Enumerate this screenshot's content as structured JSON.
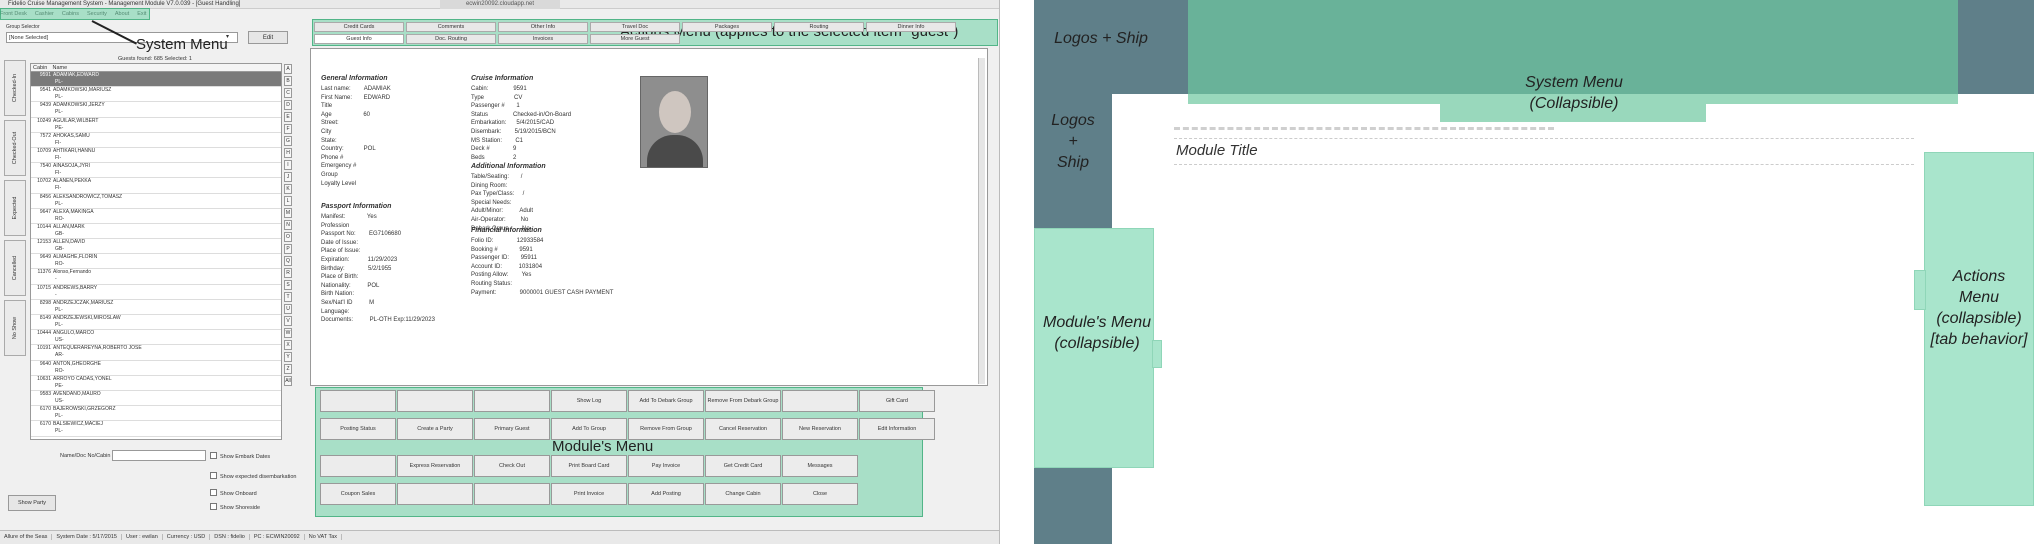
{
  "app": {
    "title": "Fidelio Cruise Management System - Management Module V7.0.039 - [Guest Handling]",
    "url": "ecwin20092.cloudapp.net",
    "menu": [
      "Front Desk",
      "Cashier",
      "Cabins",
      "Security",
      "About",
      "Exit"
    ]
  },
  "group_selector": {
    "label": "Group Selector",
    "value": "[None Selected]",
    "edit_label": "Edit"
  },
  "guest_list": {
    "found_label": "Guests found: 685 Selected: 1",
    "columns": [
      "Cabin",
      "Name"
    ],
    "side_tabs": [
      "Checked-In",
      "Checked-Out",
      "Expected",
      "Cancelled",
      "No Show"
    ],
    "rows": [
      {
        "cabin": "9591",
        "name": "ADAMIAK,EDWARD",
        "nat": "PL-"
      },
      {
        "cabin": "9541",
        "name": "ADAMKOWSKI,MARIUSZ",
        "nat": "PL-"
      },
      {
        "cabin": "9439",
        "name": "ADAMKOWSKI,JERZY",
        "nat": "PL-"
      },
      {
        "cabin": "10249",
        "name": "AGUILAR,WILBERT",
        "nat": "PE-"
      },
      {
        "cabin": "7572",
        "name": "AHOKAS,SAMU",
        "nat": "FI-"
      },
      {
        "cabin": "10709",
        "name": "AHTIKARI,HANNU",
        "nat": "FI-"
      },
      {
        "cabin": "7540",
        "name": "AINASOJA,JYRI",
        "nat": "FI-"
      },
      {
        "cabin": "10702",
        "name": "ALANEN,PEKKA",
        "nat": "FI-"
      },
      {
        "cabin": "8456",
        "name": "ALEKSANDROWICZ,TOMASZ",
        "nat": "PL-"
      },
      {
        "cabin": "9647",
        "name": "ALEXA,MAKINGA",
        "nat": "RO-"
      },
      {
        "cabin": "10144",
        "name": "ALLAN,MARK",
        "nat": "GB-"
      },
      {
        "cabin": "12153",
        "name": "ALLEN,DAVID",
        "nat": "GB-"
      },
      {
        "cabin": "9649",
        "name": "ALMAGHE,FLORIN",
        "nat": "RO-"
      },
      {
        "cabin": "11376",
        "name": "Alonso,Fernando",
        "nat": "-"
      },
      {
        "cabin": "10715",
        "name": "ANDREWS,BARRY",
        "nat": "-"
      },
      {
        "cabin": "8298",
        "name": "ANDRZEJCZAK,MARIUSZ",
        "nat": "PL-"
      },
      {
        "cabin": "8149",
        "name": "ANDRZEJEWSKI,MIROSLAW",
        "nat": "PL-"
      },
      {
        "cabin": "10444",
        "name": "ANGULO,MARCO",
        "nat": "US-"
      },
      {
        "cabin": "10191",
        "name": "ANTEQUERAREYNA,ROBERTO JOSE",
        "nat": "AR-"
      },
      {
        "cabin": "9640",
        "name": "ANTON,GHEORGHE",
        "nat": "RO-"
      },
      {
        "cabin": "10631",
        "name": "ARROYO CADAS,YONEL",
        "nat": "PE-"
      },
      {
        "cabin": "9583",
        "name": "AVENDANO,MAURO",
        "nat": "US-"
      },
      {
        "cabin": "6170",
        "name": "BAJEROWSKI,GRZEGORZ",
        "nat": "PL-"
      },
      {
        "cabin": "6170",
        "name": "BALSIEWICZ,MACIEJ",
        "nat": "PL-"
      }
    ],
    "letters": [
      "A",
      "B",
      "C",
      "D",
      "E",
      "F",
      "G",
      "H",
      "I",
      "J",
      "K",
      "L",
      "M",
      "N",
      "O",
      "P",
      "Q",
      "R",
      "S",
      "T",
      "U",
      "V",
      "W",
      "X",
      "Y",
      "Z",
      "All"
    ]
  },
  "search": {
    "label": "Name/Doc No/Cabin",
    "options": [
      "Show Embark Dates",
      "Show expected disembarkation",
      "Show Onboard",
      "Show Shoreside"
    ],
    "show_party_label": "Show Party"
  },
  "detail_tabs": {
    "top": [
      "Credit Cards",
      "Comments",
      "Other Info",
      "Travel Doc",
      "Packages",
      "Routing",
      "Dinner Info"
    ],
    "bottom": [
      "Guest Info",
      "Doc. Routing",
      "Invoices",
      "More Guest"
    ]
  },
  "detail": {
    "general_title": "General Information",
    "general": "Last name:        ADAMIAK\nFirst Name:       EDWARD\nTitle\nAge                   60\nStreet:\nCity\nState:\nCountry:            POL\nPhone #\nEmergency #\nGroup\nLoyalty Level",
    "cruise_title": "Cruise Information",
    "cruise": "Cabin:               9591\nType                  CV\nPassenger #       1\nStatus               Checked-in/On-Board\nEmbarkation:      5/4/2015/CAD\nDisembark:        5/19/2015/BCN\nMS Station:        C1\nDeck #              9\nBeds                 2",
    "additional_title": "Additional Information",
    "additional": "Table/Seating:       /\nDining Room:\nPax Type/Class:     /\nSpecial Needs:\nAdult/Minor:          Adult\nAir-Operator:         No\nDebark Group        No",
    "financial_title": "Financial Information",
    "financial": "Folio ID:              12933584\nBooking #             9591\nPassenger ID:       95911\nAccount ID:          1031804\nPosting Allow:        Yes\nRouting Status:\nPayment:              9000001 GUEST CASH PAYMENT",
    "passport_title": "Passport Information",
    "passport": "Manifest:             Yes\nProfession\nPassport No:        EG7106680\nDate of Issue:\nPlace of Issue:\nExpiration:           11/29/2023\nBirthday:              5/2/1955\nPlace of Birth:\nNationality:          POL\nBirth Nation:\nSex/Nat'l ID          M\nLanguage:\nDocuments:          PL-OTH Exp:11/29/2023"
  },
  "module_buttons": [
    [
      "",
      "",
      "",
      "Show Log",
      "Add To Debark Group",
      "Remove From Debark Group",
      "",
      "Gift Card"
    ],
    [
      "Posting Status",
      "Create a Party",
      "Primary Guest",
      "Add To Group",
      "Remove From Group",
      "Cancel Reservation",
      "New Reservation",
      "Edit Information"
    ],
    [
      "",
      "Express Reservation",
      "Check Out",
      "Print Board Card",
      "Pay Invoice",
      "Get Credit Card",
      "Messages"
    ],
    [
      "Coupon Sales",
      "",
      "",
      "Print Invoice",
      "Add Posting",
      "Change Cabin",
      "Close"
    ]
  ],
  "status_bar": [
    "Allure of the Seas",
    "System Date : 5/17/2015",
    "User : ewilan",
    "Currency : USD",
    "DSN : fidelio",
    "PC : ECWIN20092",
    "No VAT Tax"
  ],
  "annotations": {
    "system_menu": "System Menu",
    "actions_menu": "Actions Menu (applies to the selected item \"guest\")",
    "modules_menu": "Module's Menu"
  },
  "wireframe": {
    "logos_ship_top": "Logos + Ship",
    "system_menu": "System Menu\n(Collapsible)",
    "logos_ship_side": "Logos\n+\nShip",
    "module_title": "Module Title",
    "modules_menu": "Module's Menu\n(collapsible)",
    "actions_menu": "Actions\nMenu\n(collapsible)\n[tab behavior]"
  },
  "colors": {
    "overlay": "#6ed2a5",
    "wire_teal": "#5f7f89",
    "wire_mint": "#a9e5cc"
  }
}
